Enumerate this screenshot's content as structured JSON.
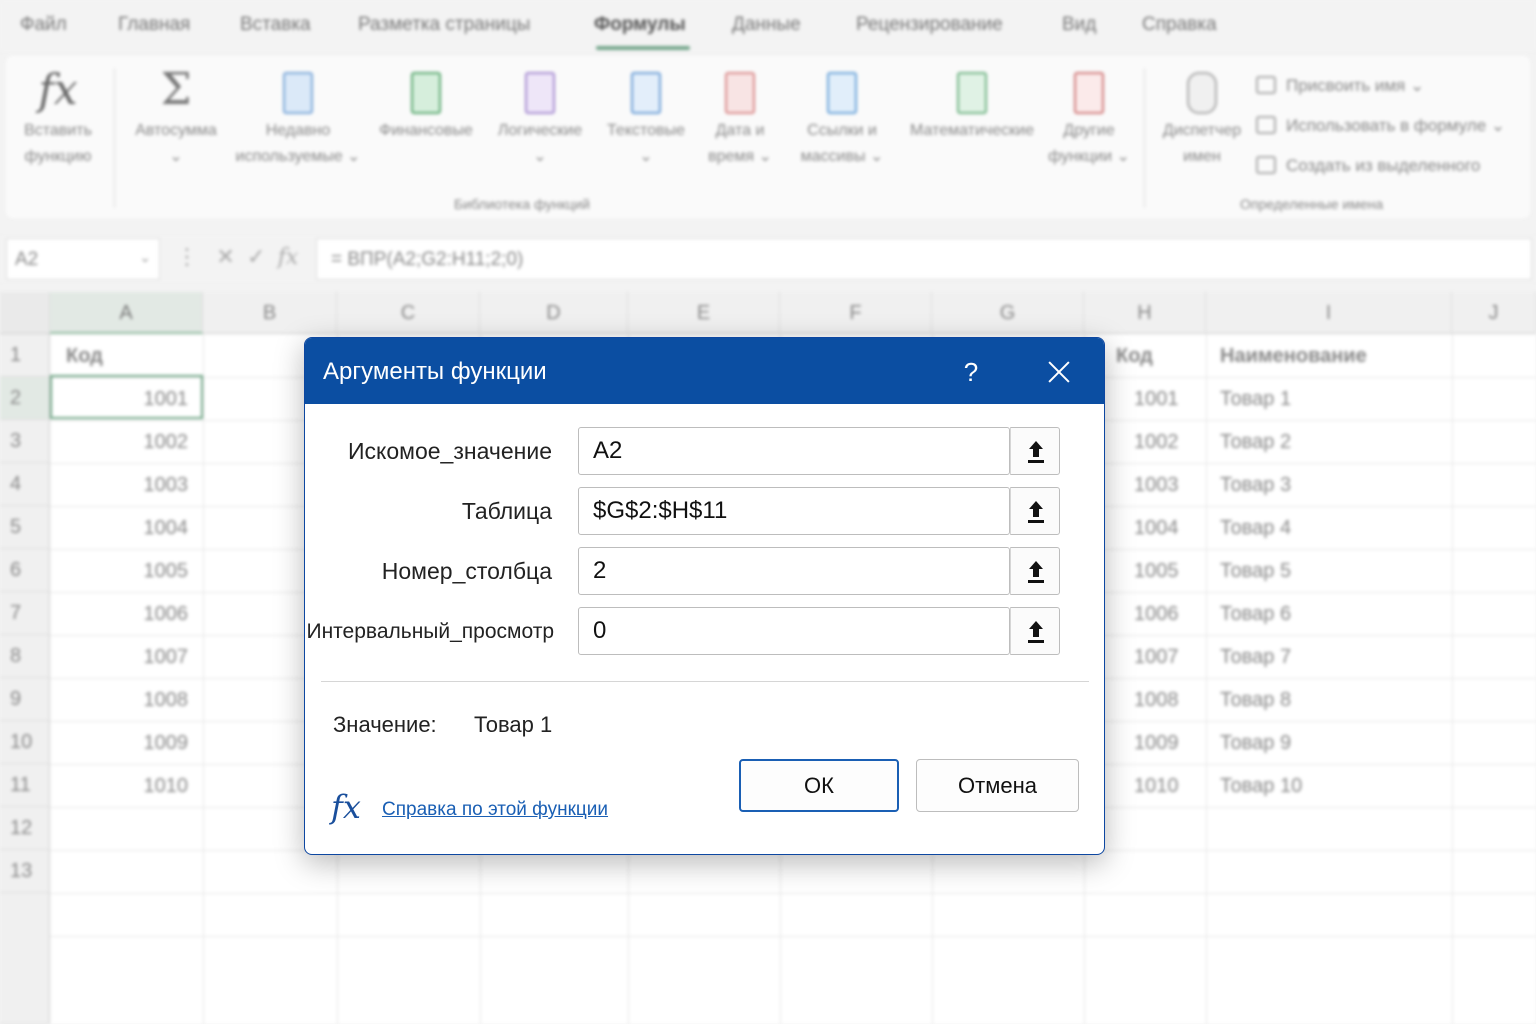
{
  "menubar": {
    "tabs": [
      "Файл",
      "Главная",
      "Вставка",
      "Разметка страницы",
      "Формулы",
      "Данные",
      "Рецензирование",
      "Вид",
      "Справка"
    ],
    "active_tab": "Формулы"
  },
  "ribbon": {
    "insert_function": [
      "Вставить",
      "функцию"
    ],
    "autosum": [
      "Автосумма",
      "⌄"
    ],
    "recent": [
      "Недавно",
      "используемые ⌄"
    ],
    "financial": [
      "Финансовые",
      ""
    ],
    "logical": [
      "Логические",
      "⌄"
    ],
    "text": [
      "Текстовые",
      "⌄"
    ],
    "datetime": [
      "Дата и",
      "время ⌄"
    ],
    "lookup": [
      "Ссылки и",
      "массивы ⌄"
    ],
    "math": [
      "Математические",
      ""
    ],
    "other": [
      "Другие",
      "функции ⌄"
    ],
    "name_manager": [
      "Диспетчер",
      "имен"
    ],
    "library_group": "Библиотека функций",
    "define_name": "Присвоить имя  ⌄",
    "use_in_formula": "Использовать в формуле  ⌄",
    "create_from_selection": "Создать из выделенного",
    "names_group": "Определенные имена"
  },
  "formula_bar": {
    "name_box": "A2",
    "formula": "= ВПР(A2;G2:H11;2;0)"
  },
  "sheet": {
    "columns": [
      "A",
      "B",
      "C",
      "D",
      "E",
      "F",
      "G",
      "H",
      "I",
      "J"
    ],
    "rows": [
      "1",
      "2",
      "3",
      "4",
      "5",
      "6",
      "7",
      "8",
      "9",
      "10",
      "11",
      "12",
      "13"
    ],
    "colA_header": "Код",
    "colA_values": [
      "1001",
      "1002",
      "1003",
      "1004",
      "1005",
      "1006",
      "1007",
      "1008",
      "1009",
      "1010"
    ],
    "colH_header": "Код",
    "colH_values": [
      "1001",
      "1002",
      "1003",
      "1004",
      "1005",
      "1006",
      "1007",
      "1008",
      "1009",
      "1010"
    ],
    "colI_header": "Наименование",
    "colI_values": [
      "Товар 1",
      "Товар 2",
      "Товар 3",
      "Товар 4",
      "Товар 5",
      "Товар 6",
      "Товар 7",
      "Товар 8",
      "Товар 9",
      "Товар 10"
    ]
  },
  "dialog": {
    "title": "Аргументы функции",
    "help_glyph": "?",
    "args": [
      {
        "label": "Искомое_значение",
        "value": "A2"
      },
      {
        "label": "Таблица",
        "value": "$G$2:$H$11"
      },
      {
        "label": "Номер_столбца",
        "value": "2"
      },
      {
        "label": "Интервальный_просмотр",
        "value": "0"
      }
    ],
    "result_label": "Значение:",
    "result_value": "Товар 1",
    "help_link": "Справка по этой функции",
    "ok": "ОК",
    "cancel": "Отмена"
  }
}
